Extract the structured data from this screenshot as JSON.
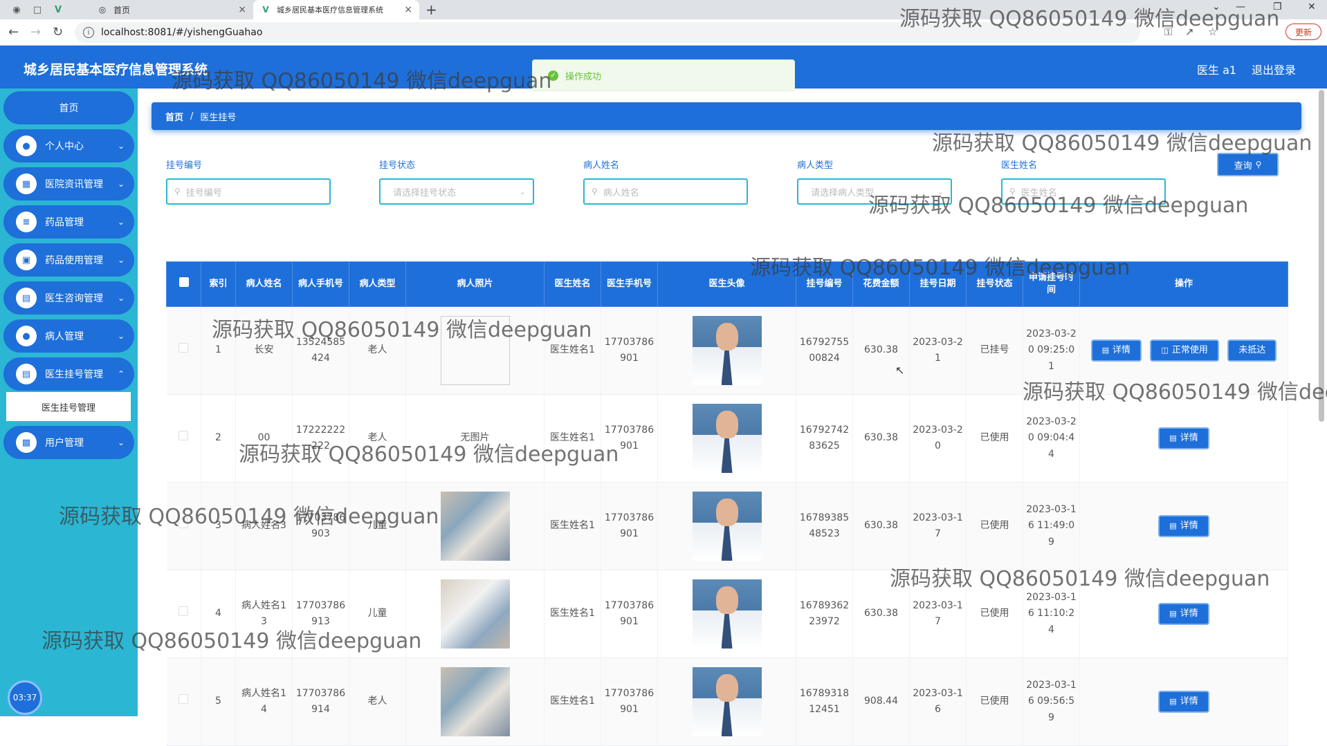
{
  "browser": {
    "tabs": [
      {
        "title": "首页",
        "icon": "globe-icon"
      },
      {
        "title": "城乡居民基本医疗信息管理系统",
        "icon": "vue-icon"
      }
    ],
    "url": "localhost:8081/#/yishengGuahao",
    "update_label": "更新"
  },
  "header": {
    "title": "城乡居民基本医疗信息管理系统",
    "user": "医生 a1",
    "logout": "退出登录"
  },
  "toast": {
    "message": "操作成功"
  },
  "sidebar": {
    "home": "首页",
    "items": [
      {
        "label": "个人中心",
        "icon": "user-icon"
      },
      {
        "label": "医院资讯管理",
        "icon": "grid-icon"
      },
      {
        "label": "药品管理",
        "icon": "list-icon"
      },
      {
        "label": "药品使用管理",
        "icon": "briefcase-icon"
      },
      {
        "label": "医生咨询管理",
        "icon": "chart-icon"
      },
      {
        "label": "病人管理",
        "icon": "user-icon"
      },
      {
        "label": "医生挂号管理",
        "icon": "doc-icon"
      },
      {
        "label": "用户管理",
        "icon": "bar-chart-icon"
      }
    ],
    "active_sub": "医生挂号管理",
    "clock": "03:37"
  },
  "breadcrumb": {
    "home": "首页",
    "current": "医生挂号"
  },
  "search": {
    "fields": [
      {
        "label": "挂号编号",
        "placeholder": "挂号编号"
      },
      {
        "label": "挂号状态",
        "placeholder": "请选择挂号状态"
      },
      {
        "label": "病人姓名",
        "placeholder": "病人姓名"
      },
      {
        "label": "病人类型",
        "placeholder": "请选择病人类型"
      },
      {
        "label": "医生姓名",
        "placeholder": "医生姓名"
      }
    ],
    "button": "查询"
  },
  "table": {
    "headers": [
      "索引",
      "病人姓名",
      "病人手机号",
      "病人类型",
      "病人照片",
      "医生姓名",
      "医生手机号",
      "医生头像",
      "挂号编号",
      "花费金额",
      "挂号日期",
      "挂号状态",
      "申请挂号时间",
      "操作"
    ],
    "rows": [
      {
        "index": "1",
        "patient": "长安",
        "phone": "13524585424",
        "ptype": "老人",
        "photo": "",
        "doctor": "医生姓名1",
        "dphone": "17703786901",
        "regno": "1679275500824",
        "cost": "630.38",
        "date": "2023-03-21",
        "status": "已挂号",
        "applied": "2023-03-20 09:25:01",
        "actions": [
          "详情",
          "正常使用",
          "未抵达"
        ]
      },
      {
        "index": "2",
        "patient": "00",
        "phone": "17222222222",
        "ptype": "老人",
        "photo": "无图片",
        "doctor": "医生姓名1",
        "dphone": "17703786901",
        "regno": "1679274283625",
        "cost": "630.38",
        "date": "2023-03-20",
        "status": "已使用",
        "applied": "2023-03-20 09:04:44",
        "actions": [
          "详情"
        ]
      },
      {
        "index": "3",
        "patient": "病人姓名3",
        "phone": "17703786903",
        "ptype": "儿童",
        "photo": "image",
        "doctor": "医生姓名1",
        "dphone": "17703786901",
        "regno": "1678938548523",
        "cost": "630.38",
        "date": "2023-03-17",
        "status": "已使用",
        "applied": "2023-03-16 11:49:09",
        "actions": [
          "详情"
        ]
      },
      {
        "index": "4",
        "patient": "病人姓名13",
        "phone": "17703786913",
        "ptype": "儿童",
        "photo": "image",
        "doctor": "医生姓名1",
        "dphone": "17703786901",
        "regno": "1678936223972",
        "cost": "630.38",
        "date": "2023-03-17",
        "status": "已使用",
        "applied": "2023-03-16 11:10:24",
        "actions": [
          "详情"
        ]
      },
      {
        "index": "5",
        "patient": "病人姓名14",
        "phone": "17703786914",
        "ptype": "老人",
        "photo": "image",
        "doctor": "医生姓名1",
        "dphone": "17703786901",
        "regno": "1678931812451",
        "cost": "908.44",
        "date": "2023-03-16",
        "status": "已使用",
        "applied": "2023-03-16 09:56:59",
        "actions": [
          "详情"
        ]
      }
    ]
  },
  "watermark": "源码获取 QQ86050149 微信deepguan",
  "colors": {
    "primary": "#1e6fd9",
    "sidebar": "#2bb6d4",
    "success": "#67c23a"
  }
}
